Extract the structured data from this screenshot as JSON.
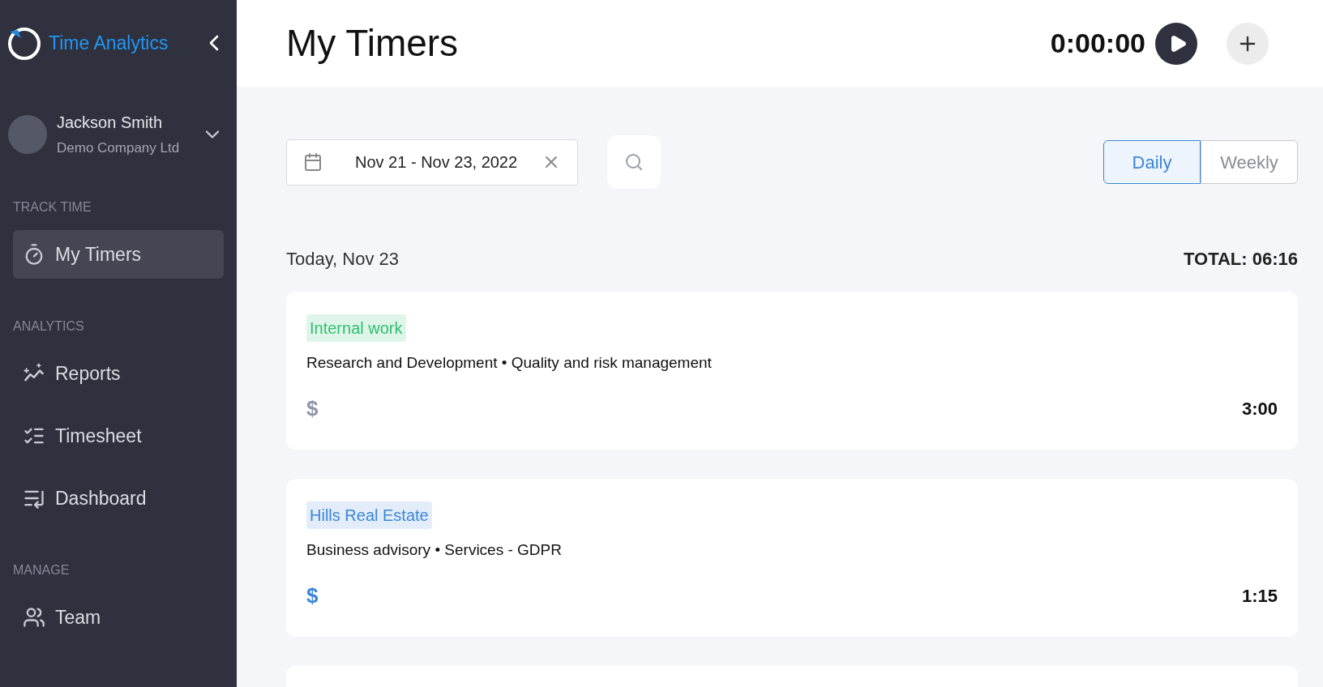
{
  "app": {
    "name": "Time Analytics"
  },
  "user": {
    "name": "Jackson Smith",
    "company": "Demo Company Ltd"
  },
  "sidebar": {
    "sections": [
      {
        "heading": "TRACK TIME",
        "items": [
          {
            "label": "My Timers",
            "kind": "stopwatch",
            "selected": true
          }
        ]
      },
      {
        "heading": "ANALYTICS",
        "items": [
          {
            "label": "Reports",
            "kind": "chart",
            "selected": false
          },
          {
            "label": "Timesheet",
            "kind": "list-check",
            "selected": false
          },
          {
            "label": "Dashboard",
            "kind": "list-down",
            "selected": false
          }
        ]
      },
      {
        "heading": "MANAGE",
        "items": [
          {
            "label": "Team",
            "kind": "team",
            "selected": false
          }
        ]
      }
    ]
  },
  "header": {
    "title": "My Timers",
    "timer": "0:00:00"
  },
  "filters": {
    "date_range": "Nov 21 - Nov 23, 2022",
    "views": [
      {
        "label": "Daily",
        "selected": true
      },
      {
        "label": "Weekly",
        "selected": false
      }
    ]
  },
  "day": {
    "label": "Today, Nov 23",
    "total": "TOTAL: 06:16"
  },
  "entries": [
    {
      "tag": "Internal work",
      "color": "#2fbf71",
      "description": "Research and Development • Quality and risk management",
      "currency": "$",
      "billable": false,
      "duration": "3:00"
    },
    {
      "tag": "Hills Real Estate",
      "color": "#3b86d8",
      "description": "Business advisory • Services - GDPR",
      "currency": "$",
      "billable": true,
      "duration": "1:15"
    }
  ]
}
